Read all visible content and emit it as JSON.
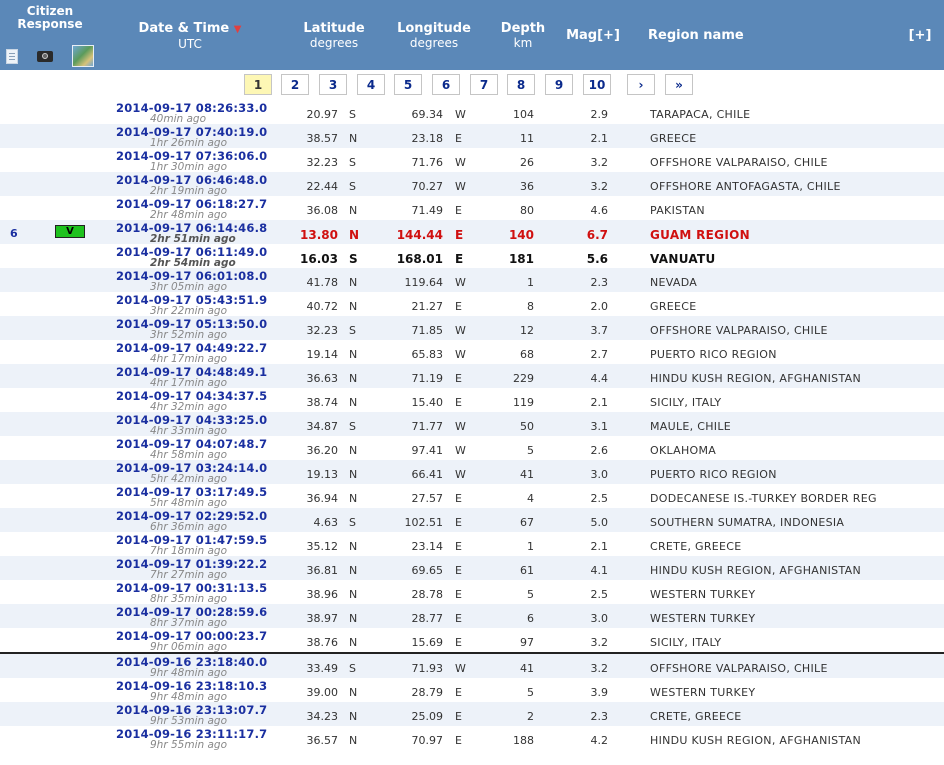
{
  "header": {
    "citizen_response": "Citizen Response",
    "date_time": "Date & Time",
    "date_time_sort_arrow": "▼",
    "utc": "UTC",
    "latitude": "Latitude",
    "latitude_unit": "degrees",
    "longitude": "Longitude",
    "longitude_unit": "degrees",
    "depth": "Depth",
    "depth_unit": "km",
    "mag": "Mag[+]",
    "region": "Region name",
    "expand": "[+]"
  },
  "icons": [
    "document-icon",
    "camera-icon",
    "map-icon"
  ],
  "pagination": {
    "pages": [
      "1",
      "2",
      "3",
      "4",
      "5",
      "6",
      "7",
      "8",
      "9",
      "10"
    ],
    "active": "1",
    "next": "›",
    "last": "»"
  },
  "rows": [
    {
      "datetime": "2014-09-17   08:26:33.0",
      "ago": "40min ago",
      "lat": "20.97",
      "ns": "S",
      "lon": "69.34",
      "ew": "W",
      "depth": "104",
      "mag": "2.9",
      "region": "TARAPACA, CHILE"
    },
    {
      "datetime": "2014-09-17   07:40:19.0",
      "ago": "1hr 26min ago",
      "lat": "38.57",
      "ns": "N",
      "lon": "23.18",
      "ew": "E",
      "depth": "11",
      "mag": "2.1",
      "region": "GREECE"
    },
    {
      "datetime": "2014-09-17   07:36:06.0",
      "ago": "1hr 30min ago",
      "lat": "32.23",
      "ns": "S",
      "lon": "71.76",
      "ew": "W",
      "depth": "26",
      "mag": "3.2",
      "region": "OFFSHORE VALPARAISO, CHILE"
    },
    {
      "datetime": "2014-09-17   06:46:48.0",
      "ago": "2hr 19min ago",
      "lat": "22.44",
      "ns": "S",
      "lon": "70.27",
      "ew": "W",
      "depth": "36",
      "mag": "3.2",
      "region": "OFFSHORE ANTOFAGASTA, CHILE"
    },
    {
      "datetime": "2014-09-17   06:18:27.7",
      "ago": "2hr 48min ago",
      "lat": "36.08",
      "ns": "N",
      "lon": "71.49",
      "ew": "E",
      "depth": "80",
      "mag": "4.6",
      "region": "PAKISTAN"
    },
    {
      "datetime": "2014-09-17   06:14:46.8",
      "ago": "2hr 51min ago",
      "lat": "13.80",
      "ns": "N",
      "lon": "144.44",
      "ew": "E",
      "depth": "140",
      "mag": "6.7",
      "region": "GUAM REGION",
      "style": "red",
      "reports": "6",
      "badge": "V"
    },
    {
      "datetime": "2014-09-17   06:11:49.0",
      "ago": "2hr 54min ago",
      "lat": "16.03",
      "ns": "S",
      "lon": "168.01",
      "ew": "E",
      "depth": "181",
      "mag": "5.6",
      "region": "VANUATU",
      "style": "bold"
    },
    {
      "datetime": "2014-09-17   06:01:08.0",
      "ago": "3hr 05min ago",
      "lat": "41.78",
      "ns": "N",
      "lon": "119.64",
      "ew": "W",
      "depth": "1",
      "mag": "2.3",
      "region": "NEVADA"
    },
    {
      "datetime": "2014-09-17   05:43:51.9",
      "ago": "3hr 22min ago",
      "lat": "40.72",
      "ns": "N",
      "lon": "21.27",
      "ew": "E",
      "depth": "8",
      "mag": "2.0",
      "region": "GREECE"
    },
    {
      "datetime": "2014-09-17   05:13:50.0",
      "ago": "3hr 52min ago",
      "lat": "32.23",
      "ns": "S",
      "lon": "71.85",
      "ew": "W",
      "depth": "12",
      "mag": "3.7",
      "region": "OFFSHORE VALPARAISO, CHILE"
    },
    {
      "datetime": "2014-09-17   04:49:22.7",
      "ago": "4hr 17min ago",
      "lat": "19.14",
      "ns": "N",
      "lon": "65.83",
      "ew": "W",
      "depth": "68",
      "mag": "2.7",
      "region": "PUERTO RICO REGION"
    },
    {
      "datetime": "2014-09-17   04:48:49.1",
      "ago": "4hr 17min ago",
      "lat": "36.63",
      "ns": "N",
      "lon": "71.19",
      "ew": "E",
      "depth": "229",
      "mag": "4.4",
      "region": "HINDU KUSH REGION, AFGHANISTAN"
    },
    {
      "datetime": "2014-09-17   04:34:37.5",
      "ago": "4hr 32min ago",
      "lat": "38.74",
      "ns": "N",
      "lon": "15.40",
      "ew": "E",
      "depth": "119",
      "mag": "2.1",
      "region": "SICILY, ITALY"
    },
    {
      "datetime": "2014-09-17   04:33:25.0",
      "ago": "4hr 33min ago",
      "lat": "34.87",
      "ns": "S",
      "lon": "71.77",
      "ew": "W",
      "depth": "50",
      "mag": "3.1",
      "region": "MAULE, CHILE"
    },
    {
      "datetime": "2014-09-17   04:07:48.7",
      "ago": "4hr 58min ago",
      "lat": "36.20",
      "ns": "N",
      "lon": "97.41",
      "ew": "W",
      "depth": "5",
      "mag": "2.6",
      "region": "OKLAHOMA"
    },
    {
      "datetime": "2014-09-17   03:24:14.0",
      "ago": "5hr 42min ago",
      "lat": "19.13",
      "ns": "N",
      "lon": "66.41",
      "ew": "W",
      "depth": "41",
      "mag": "3.0",
      "region": "PUERTO RICO REGION"
    },
    {
      "datetime": "2014-09-17   03:17:49.5",
      "ago": "5hr 48min ago",
      "lat": "36.94",
      "ns": "N",
      "lon": "27.57",
      "ew": "E",
      "depth": "4",
      "mag": "2.5",
      "region": "DODECANESE IS.-TURKEY BORDER REG"
    },
    {
      "datetime": "2014-09-17   02:29:52.0",
      "ago": "6hr 36min ago",
      "lat": "4.63",
      "ns": "S",
      "lon": "102.51",
      "ew": "E",
      "depth": "67",
      "mag": "5.0",
      "region": "SOUTHERN SUMATRA, INDONESIA"
    },
    {
      "datetime": "2014-09-17   01:47:59.5",
      "ago": "7hr 18min ago",
      "lat": "35.12",
      "ns": "N",
      "lon": "23.14",
      "ew": "E",
      "depth": "1",
      "mag": "2.1",
      "region": "CRETE, GREECE"
    },
    {
      "datetime": "2014-09-17   01:39:22.2",
      "ago": "7hr 27min ago",
      "lat": "36.81",
      "ns": "N",
      "lon": "69.65",
      "ew": "E",
      "depth": "61",
      "mag": "4.1",
      "region": "HINDU KUSH REGION, AFGHANISTAN"
    },
    {
      "datetime": "2014-09-17   00:31:13.5",
      "ago": "8hr 35min ago",
      "lat": "38.96",
      "ns": "N",
      "lon": "28.78",
      "ew": "E",
      "depth": "5",
      "mag": "2.5",
      "region": "WESTERN TURKEY"
    },
    {
      "datetime": "2014-09-17   00:28:59.6",
      "ago": "8hr 37min ago",
      "lat": "38.97",
      "ns": "N",
      "lon": "28.77",
      "ew": "E",
      "depth": "6",
      "mag": "3.0",
      "region": "WESTERN TURKEY"
    },
    {
      "datetime": "2014-09-17   00:00:23.7",
      "ago": "9hr 06min ago",
      "lat": "38.76",
      "ns": "N",
      "lon": "15.69",
      "ew": "E",
      "depth": "97",
      "mag": "3.2",
      "region": "SICILY, ITALY"
    },
    {
      "datetime": "2014-09-16   23:18:40.0",
      "ago": "9hr 48min ago",
      "lat": "33.49",
      "ns": "S",
      "lon": "71.93",
      "ew": "W",
      "depth": "41",
      "mag": "3.2",
      "region": "OFFSHORE VALPARAISO, CHILE",
      "sep": true
    },
    {
      "datetime": "2014-09-16   23:18:10.3",
      "ago": "9hr 48min ago",
      "lat": "39.00",
      "ns": "N",
      "lon": "28.79",
      "ew": "E",
      "depth": "5",
      "mag": "3.9",
      "region": "WESTERN TURKEY"
    },
    {
      "datetime": "2014-09-16   23:13:07.7",
      "ago": "9hr 53min ago",
      "lat": "34.23",
      "ns": "N",
      "lon": "25.09",
      "ew": "E",
      "depth": "2",
      "mag": "2.3",
      "region": "CRETE, GREECE"
    },
    {
      "datetime": "2014-09-16   23:11:17.7",
      "ago": "9hr 55min ago",
      "lat": "36.57",
      "ns": "N",
      "lon": "70.97",
      "ew": "E",
      "depth": "188",
      "mag": "4.2",
      "region": "HINDU KUSH REGION, AFGHANISTAN"
    }
  ]
}
